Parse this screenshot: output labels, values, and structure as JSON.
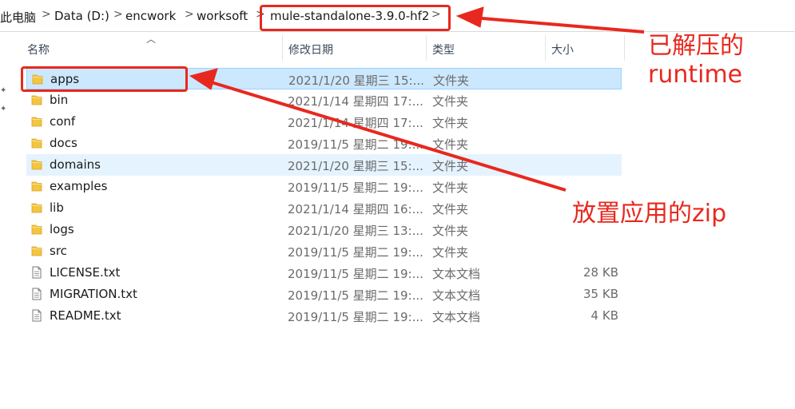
{
  "breadcrumb": {
    "items": [
      "此电脑",
      "Data (D:)",
      "encwork",
      "worksoft",
      "mule-standalone-3.9.0-hf2"
    ],
    "separator": ">"
  },
  "columns": {
    "name": "名称",
    "date": "修改日期",
    "type": "类型",
    "size": "大小"
  },
  "files": [
    {
      "name": "apps",
      "date": "2021/1/20 星期三 15:...",
      "type": "文件夹",
      "size": "",
      "kind": "folder"
    },
    {
      "name": "bin",
      "date": "2021/1/14 星期四 17:...",
      "type": "文件夹",
      "size": "",
      "kind": "folder"
    },
    {
      "name": "conf",
      "date": "2021/1/14 星期四 17:...",
      "type": "文件夹",
      "size": "",
      "kind": "folder"
    },
    {
      "name": "docs",
      "date": "2019/11/5 星期二 19:...",
      "type": "文件夹",
      "size": "",
      "kind": "folder"
    },
    {
      "name": "domains",
      "date": "2021/1/20 星期三 15:...",
      "type": "文件夹",
      "size": "",
      "kind": "folder"
    },
    {
      "name": "examples",
      "date": "2019/11/5 星期二 19:...",
      "type": "文件夹",
      "size": "",
      "kind": "folder"
    },
    {
      "name": "lib",
      "date": "2021/1/14 星期四 16:...",
      "type": "文件夹",
      "size": "",
      "kind": "folder"
    },
    {
      "name": "logs",
      "date": "2021/1/20 星期三 13:...",
      "type": "文件夹",
      "size": "",
      "kind": "folder"
    },
    {
      "name": "src",
      "date": "2019/11/5 星期二 19:...",
      "type": "文件夹",
      "size": "",
      "kind": "folder"
    },
    {
      "name": "LICENSE.txt",
      "date": "2019/11/5 星期二 19:...",
      "type": "文本文档",
      "size": "28 KB",
      "kind": "text"
    },
    {
      "name": "MIGRATION.txt",
      "date": "2019/11/5 星期二 19:...",
      "type": "文本文档",
      "size": "35 KB",
      "kind": "text"
    },
    {
      "name": "README.txt",
      "date": "2019/11/5 星期二 19:...",
      "type": "文本文档",
      "size": "4 KB",
      "kind": "text"
    }
  ],
  "annotations": {
    "runtime_line1": "已解压的",
    "runtime_line2": "runtime",
    "zip_note": "放置应用的zip"
  },
  "colors": {
    "annotation": "#e8281e",
    "selected_bg": "#cce8ff",
    "hover_bg": "#e5f3ff",
    "folder": "#f4c542"
  }
}
